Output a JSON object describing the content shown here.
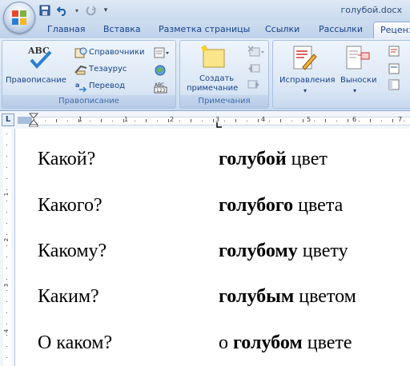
{
  "window": {
    "title": "голубой.docx"
  },
  "tabs": [
    "Главная",
    "Вставка",
    "Разметка страницы",
    "Ссылки",
    "Рассылки",
    "Рецензирование"
  ],
  "ribbon": {
    "proofing": {
      "label": "Правописание",
      "spelling": "Правописание",
      "research": "Справочники",
      "thesaurus": "Тезаурус",
      "translate": "Перевод"
    },
    "comments": {
      "label": "Примечания",
      "new_comment_line1": "Создать",
      "new_comment_line2": "примечание"
    },
    "tracking": {
      "track_changes": "Исправления",
      "balloons": "Выноски"
    }
  },
  "ruler": {
    "numbers": [
      "1",
      "1",
      "2",
      "3",
      "4",
      "5",
      "6",
      "7"
    ],
    "corner": "L"
  },
  "vruler": {
    "numbers": [
      "1",
      "2",
      "3",
      "4"
    ]
  },
  "document": {
    "rows": [
      {
        "question": "Какой?",
        "pre": "",
        "bold": "голубой",
        "post": " цвет"
      },
      {
        "question": "Какого?",
        "pre": "",
        "bold": "голубого",
        "post": " цвета"
      },
      {
        "question": "Какому?",
        "pre": "",
        "bold": "голубому",
        "post": " цвету"
      },
      {
        "question": "Каким?",
        "pre": "",
        "bold": "голубым",
        "post": " цветом"
      },
      {
        "question": "О каком?",
        "pre": "о ",
        "bold": "голубом",
        "post": " цвете"
      }
    ]
  }
}
